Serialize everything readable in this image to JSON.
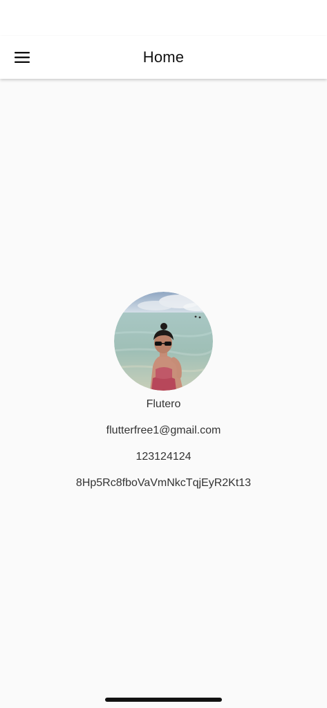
{
  "app_bar": {
    "title": "Home",
    "menu_icon": "hamburger-menu-icon"
  },
  "profile": {
    "avatar_description": "profile-photo",
    "name": "Flutero",
    "email": "flutterfree1@gmail.com",
    "phone": "123124124",
    "uid": "8Hp5Rc8fboVaVmNkcTqjEyR2Kt13"
  },
  "colors": {
    "background": "#fafafa",
    "app_bar": "#ffffff",
    "text": "#333333"
  }
}
